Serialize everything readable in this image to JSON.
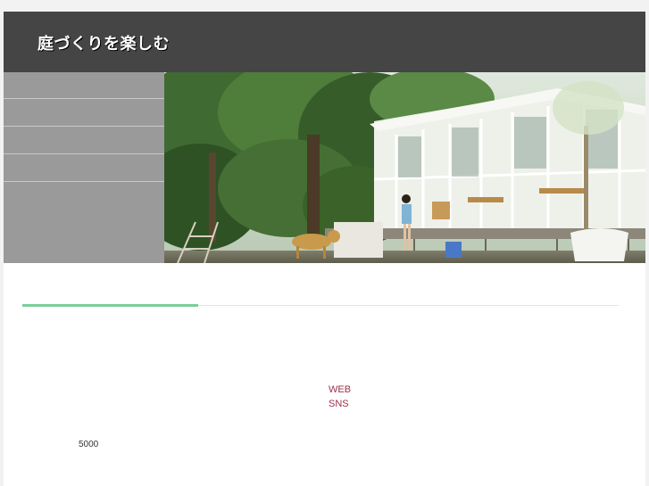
{
  "header": {
    "site_title": "庭づくりを楽しむ",
    "background_color": "#454545"
  },
  "sidebar": {
    "background_color": "#9a9a9a",
    "items": [
      {
        "label": ""
      },
      {
        "label": ""
      },
      {
        "label": ""
      },
      {
        "label": ""
      }
    ]
  },
  "hero": {
    "image": "garden-house-photo"
  },
  "tabs": {
    "accent_color": "#7ccf9a"
  },
  "content": {
    "link_web": "WEB",
    "link_sns": "SNS",
    "value": "5000"
  }
}
